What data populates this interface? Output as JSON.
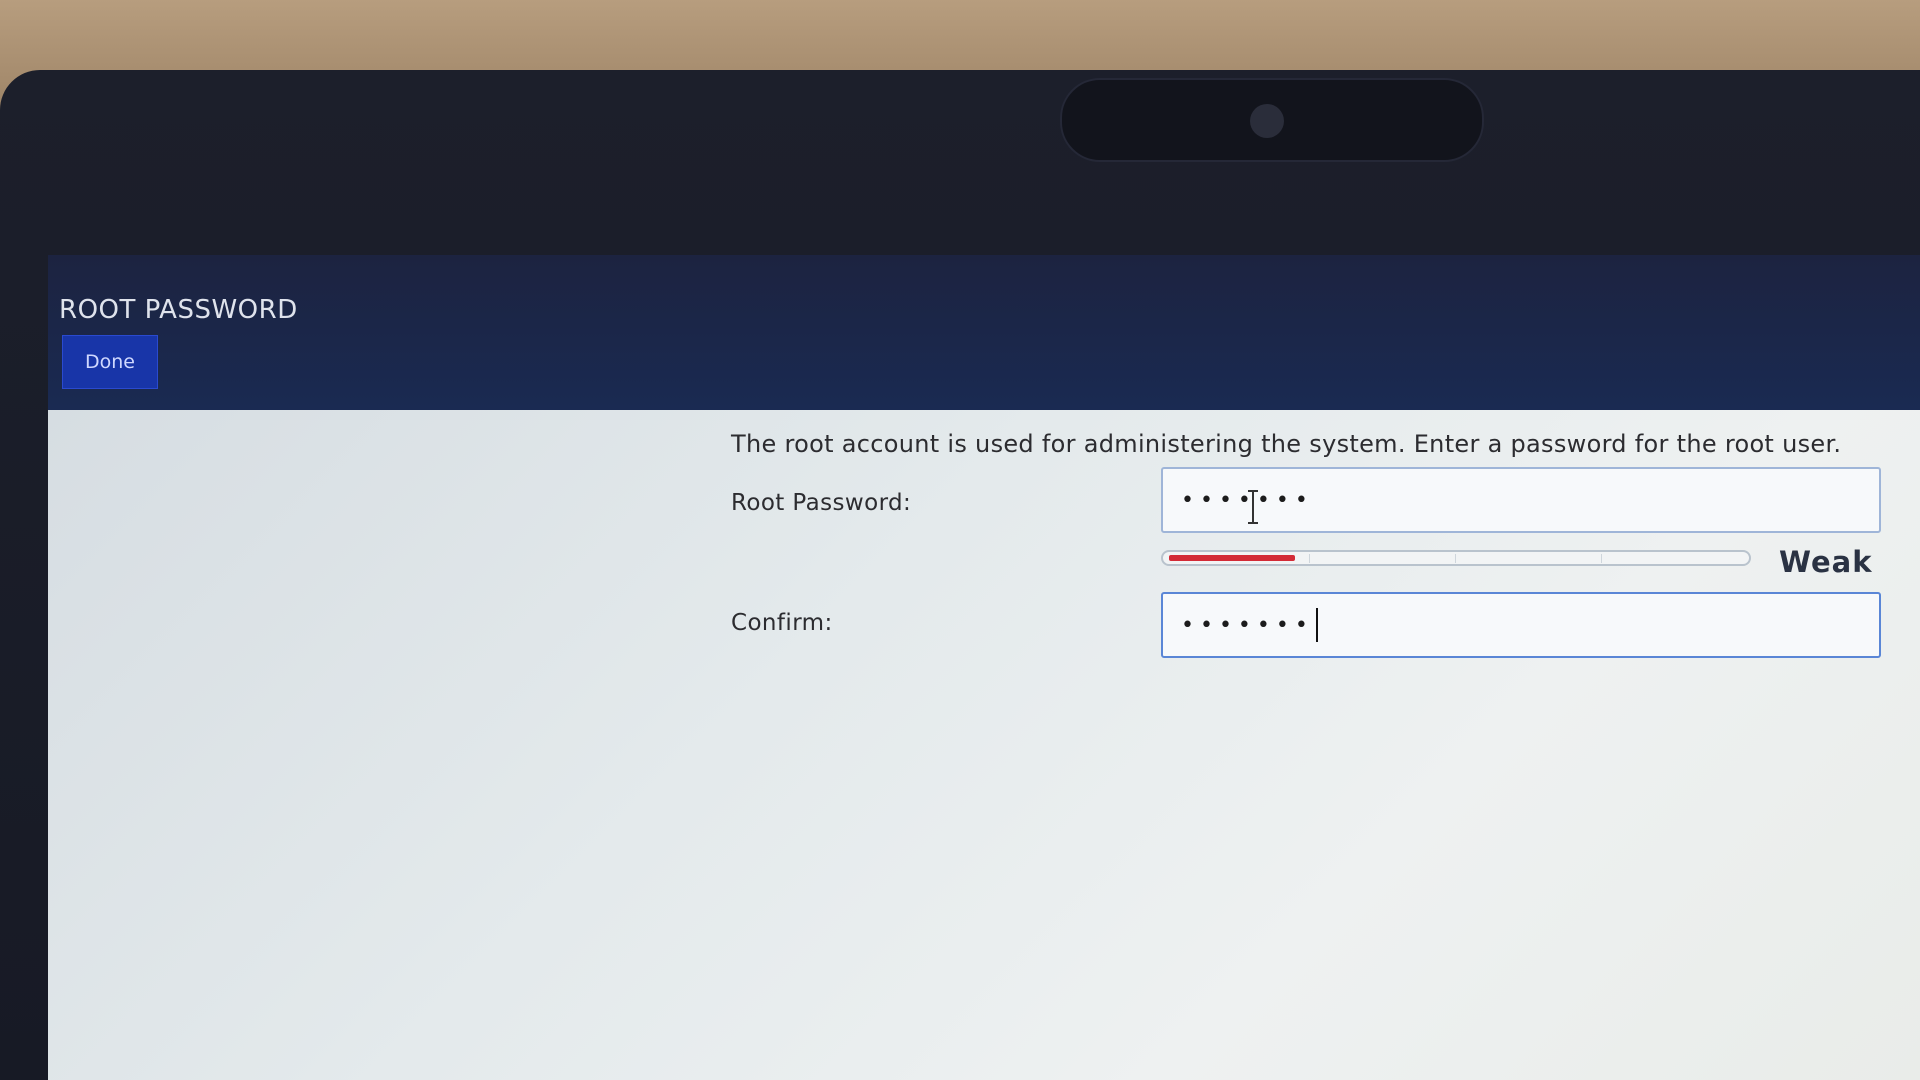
{
  "header": {
    "title": "ROOT PASSWORD",
    "done_label": "Done"
  },
  "main": {
    "intro": "The root account is used for administering the system.  Enter a password for the root user.",
    "root_password": {
      "label": "Root Password:",
      "masked_value": "•••••••"
    },
    "strength": {
      "label": "Weak",
      "level": 0.22,
      "color": "#d32b37"
    },
    "confirm": {
      "label": "Confirm:",
      "masked_value": "•••••••"
    }
  },
  "icons": {
    "cursor": "i-beam-cursor-icon"
  }
}
